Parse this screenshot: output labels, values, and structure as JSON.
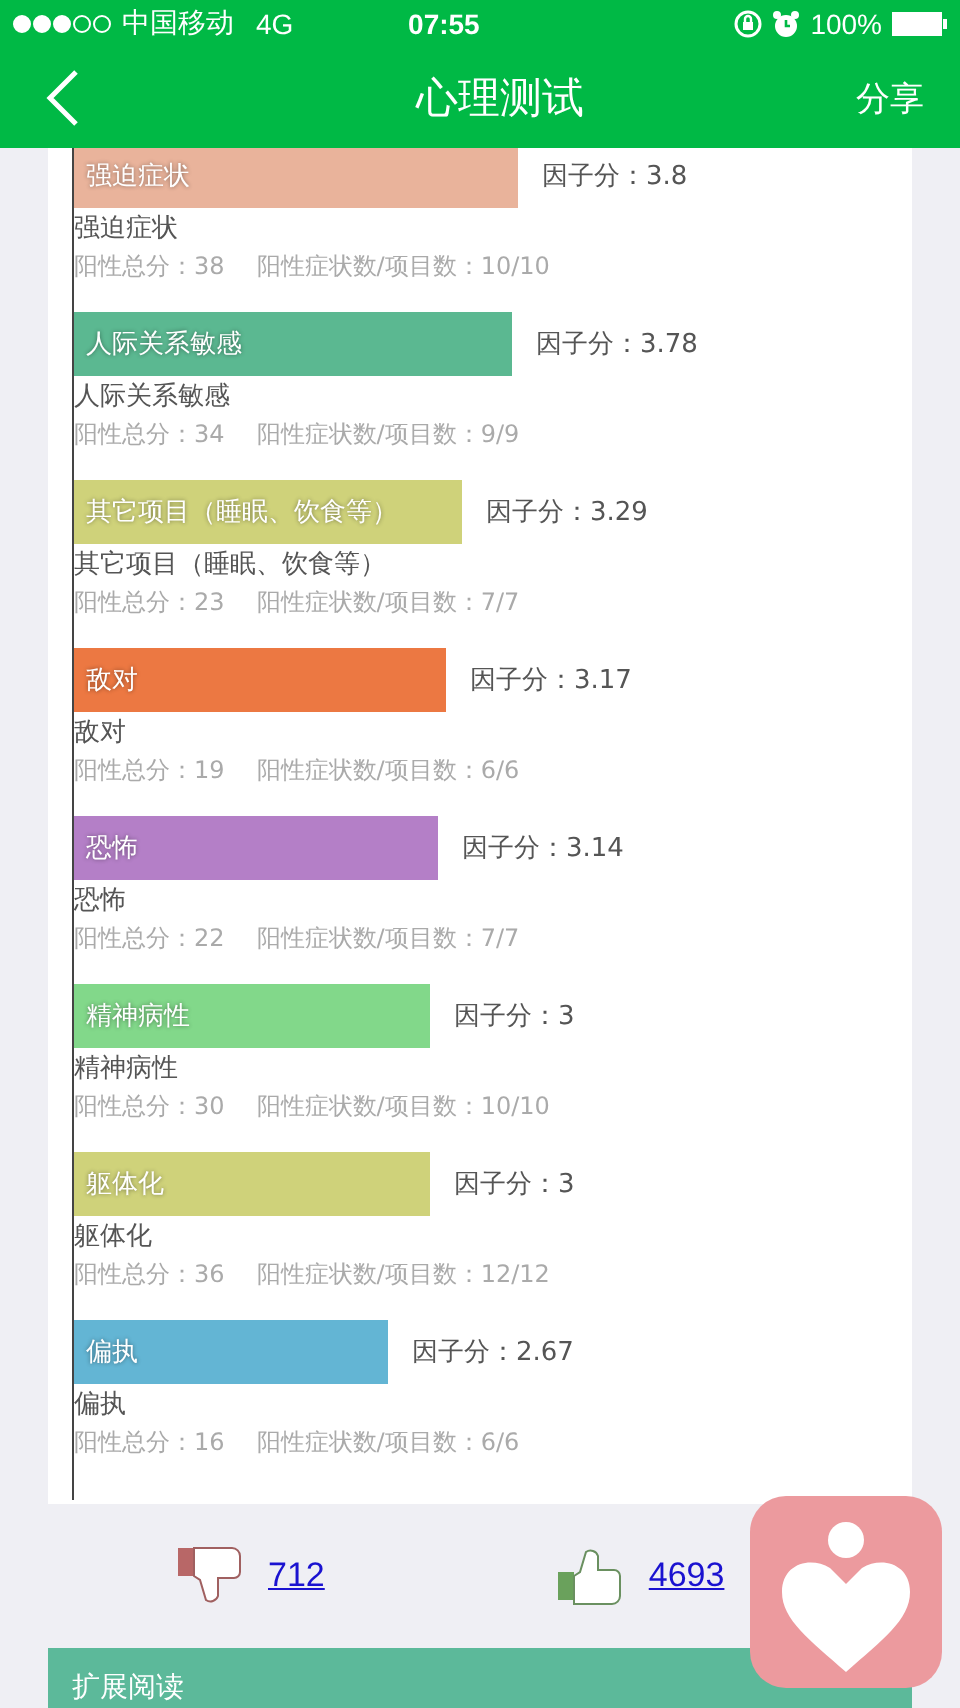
{
  "status_bar": {
    "carrier": "中国移动",
    "network": "4G",
    "time": "07:55",
    "battery": "100%"
  },
  "nav": {
    "title": "心理测试",
    "action": "分享"
  },
  "factors": [
    {
      "name": "强迫症状",
      "score_label": "因子分：3.8",
      "label": "强迫症状",
      "total": "阳性总分：38",
      "count": "阳性症状数/项目数：10/10",
      "color": "#e9b39b"
    },
    {
      "name": "人际关系敏感",
      "score_label": "因子分：3.78",
      "label": "人际关系敏感",
      "total": "阳性总分：34",
      "count": "阳性症状数/项目数：9/9",
      "color": "#5bb891"
    },
    {
      "name": "其它项目（睡眠、饮食等）",
      "score_label": "因子分：3.29",
      "label": "其它项目（睡眠、饮食等）",
      "total": "阳性总分：23",
      "count": "阳性症状数/项目数：7/7",
      "color": "#cfd27a"
    },
    {
      "name": "敌对",
      "score_label": "因子分：3.17",
      "label": "敌对",
      "total": "阳性总分：19",
      "count": "阳性症状数/项目数：6/6",
      "color": "#ec7842"
    },
    {
      "name": "恐怖",
      "score_label": "因子分：3.14",
      "label": "恐怖",
      "total": "阳性总分：22",
      "count": "阳性症状数/项目数：7/7",
      "color": "#b47fc7"
    },
    {
      "name": "精神病性",
      "score_label": "因子分：3",
      "label": "精神病性",
      "total": "阳性总分：30",
      "count": "阳性症状数/项目数：10/10",
      "color": "#82d88a"
    },
    {
      "name": "躯体化",
      "score_label": "因子分：3",
      "label": "躯体化",
      "total": "阳性总分：36",
      "count": "阳性症状数/项目数：12/12",
      "color": "#cfd27a"
    },
    {
      "name": "偏执",
      "score_label": "因子分：2.67",
      "label": "偏执",
      "total": "阳性总分：16",
      "count": "阳性症状数/项目数：6/6",
      "color": "#63b5d4"
    }
  ],
  "votes": {
    "dislikes": "712",
    "likes": "4693"
  },
  "section": {
    "title": "扩展阅读"
  }
}
